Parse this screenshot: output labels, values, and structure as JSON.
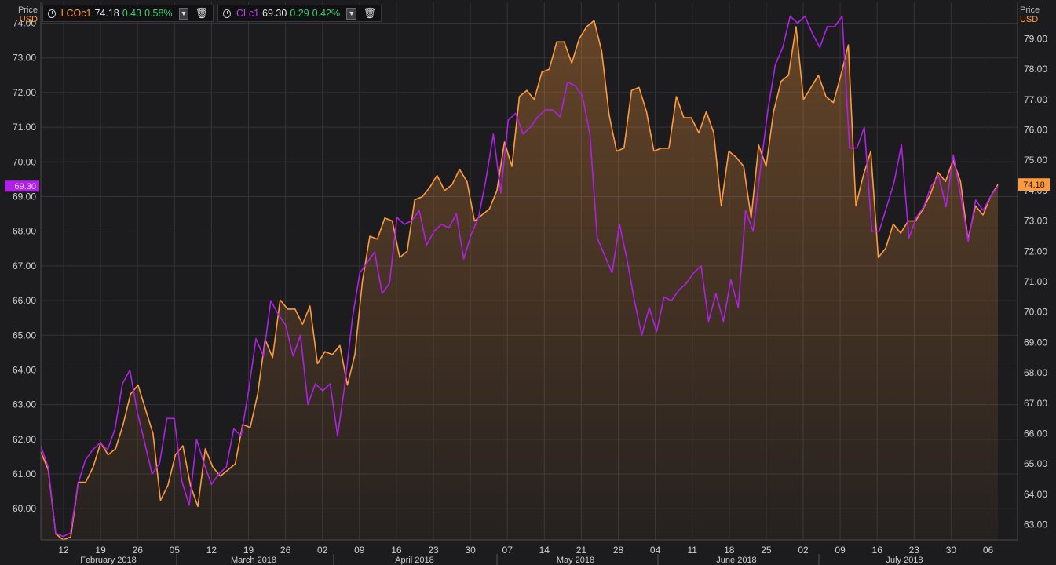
{
  "legend": [
    {
      "name": "LCOc1",
      "price": "74.18",
      "change": "0.43",
      "pct": "0.58%",
      "color": "#ff9a3c"
    },
    {
      "name": "CLc1",
      "price": "69.30",
      "change": "0.29",
      "pct": "0.42%",
      "color": "#b020e8"
    }
  ],
  "left_axis": {
    "title": "Price",
    "unit": "USD",
    "unit_color": "#ff9a3c"
  },
  "right_axis": {
    "title": "Price",
    "unit": "USD",
    "unit_color": "#ff9a3c"
  },
  "last_labels": {
    "left": "69.30",
    "right": "74.18"
  },
  "colors": {
    "background": "#1c1c1e",
    "brent": "#ff9a3c",
    "wti": "#b020e8",
    "grid": "#38383c"
  },
  "chart_data": {
    "type": "line",
    "x_tick_labels": [
      "12",
      "19",
      "26",
      "05",
      "12",
      "19",
      "26",
      "02",
      "09",
      "16",
      "23",
      "30",
      "07",
      "14",
      "21",
      "28",
      "04",
      "11",
      "18",
      "25",
      "02",
      "09",
      "16",
      "23",
      "30",
      "06"
    ],
    "month_labels": [
      "February 2018",
      "March 2018",
      "April 2018",
      "May 2018",
      "June 2018",
      "July 2018"
    ],
    "left_axis_range": [
      59.1,
      74.6
    ],
    "left_ticks": [
      "60.00",
      "61.00",
      "62.00",
      "63.00",
      "64.00",
      "65.00",
      "66.00",
      "67.00",
      "68.00",
      "69.00",
      "70.00",
      "71.00",
      "72.00",
      "73.00",
      "74.00"
    ],
    "right_axis_range": [
      62.5,
      80.2
    ],
    "right_ticks": [
      "63.00",
      "64.00",
      "65.00",
      "66.00",
      "67.00",
      "68.00",
      "69.00",
      "70.00",
      "71.00",
      "72.00",
      "73.00",
      "74.00",
      "75.00",
      "76.00",
      "77.00",
      "78.00",
      "79.00"
    ],
    "series": [
      {
        "name": "LCOc1",
        "axis": "right",
        "area": true,
        "values": [
          65.4,
          64.8,
          62.7,
          62.5,
          62.6,
          64.4,
          64.4,
          64.9,
          65.7,
          65.3,
          65.5,
          66.3,
          67.3,
          67.6,
          66.8,
          66.0,
          63.8,
          64.3,
          65.3,
          65.6,
          64.3,
          63.6,
          65.5,
          64.9,
          64.6,
          64.8,
          65.0,
          66.3,
          66.2,
          67.3,
          69.1,
          68.5,
          70.4,
          70.1,
          70.1,
          69.6,
          70.2,
          68.3,
          68.7,
          68.6,
          68.9,
          67.6,
          68.6,
          71.0,
          72.5,
          72.4,
          73.1,
          73.0,
          71.8,
          72.0,
          73.7,
          73.8,
          74.1,
          74.5,
          74.0,
          74.2,
          74.7,
          74.3,
          73.0,
          73.2,
          73.4,
          74.0,
          75.6,
          74.8,
          77.1,
          77.3,
          77.0,
          77.9,
          78.0,
          78.9,
          78.9,
          78.2,
          79.0,
          79.4,
          79.6,
          78.6,
          76.5,
          75.3,
          75.4,
          77.3,
          77.4,
          76.6,
          75.3,
          75.4,
          75.4,
          77.1,
          76.4,
          76.4,
          75.9,
          76.6,
          75.9,
          73.5,
          75.3,
          75.1,
          74.8,
          73.1,
          75.5,
          74.8,
          76.6,
          77.6,
          77.8,
          79.4,
          77.0,
          77.4,
          77.8,
          77.1,
          76.9,
          77.8,
          78.8,
          73.5,
          74.5,
          75.3,
          71.8,
          72.1,
          72.9,
          72.6,
          73.0,
          73.0,
          73.4,
          73.9,
          74.6,
          74.3,
          75.0,
          74.3,
          72.4,
          73.5,
          73.2,
          73.8,
          74.2
        ]
      },
      {
        "name": "CLc1",
        "axis": "left",
        "values": [
          61.8,
          61.2,
          59.3,
          59.2,
          59.3,
          60.7,
          61.4,
          61.7,
          61.9,
          61.7,
          62.3,
          63.6,
          64.0,
          62.8,
          61.9,
          61.0,
          61.3,
          62.6,
          62.6,
          60.8,
          60.1,
          62.0,
          61.3,
          60.7,
          61.0,
          61.2,
          62.3,
          62.1,
          63.4,
          64.9,
          64.4,
          66.0,
          65.6,
          65.3,
          64.4,
          65.0,
          63.0,
          63.6,
          63.4,
          63.6,
          62.1,
          63.6,
          65.5,
          66.8,
          67.1,
          67.4,
          66.2,
          66.5,
          68.4,
          68.2,
          68.3,
          68.6,
          67.6,
          68.0,
          68.2,
          68.1,
          68.5,
          67.2,
          67.9,
          68.4,
          69.5,
          70.8,
          69.1,
          71.2,
          71.4,
          70.8,
          71.0,
          71.3,
          71.5,
          71.5,
          71.3,
          72.3,
          72.2,
          71.9,
          70.8,
          67.8,
          67.3,
          66.8,
          68.2,
          67.2,
          66.0,
          65.0,
          65.8,
          65.1,
          66.1,
          66.0,
          66.3,
          66.5,
          66.8,
          67.0,
          65.4,
          66.2,
          65.4,
          66.6,
          65.8,
          68.6,
          68.0,
          69.8,
          71.5,
          72.8,
          73.3,
          74.2,
          74.0,
          74.2,
          73.7,
          73.3,
          73.9,
          73.9,
          74.2,
          70.4,
          70.4,
          71.0,
          68.0,
          68.0,
          68.7,
          69.4,
          70.5,
          67.8,
          68.4,
          68.7,
          69.3,
          69.6,
          68.7,
          70.2,
          69.0,
          67.7,
          68.9,
          68.6,
          69.0,
          69.3
        ]
      }
    ]
  }
}
